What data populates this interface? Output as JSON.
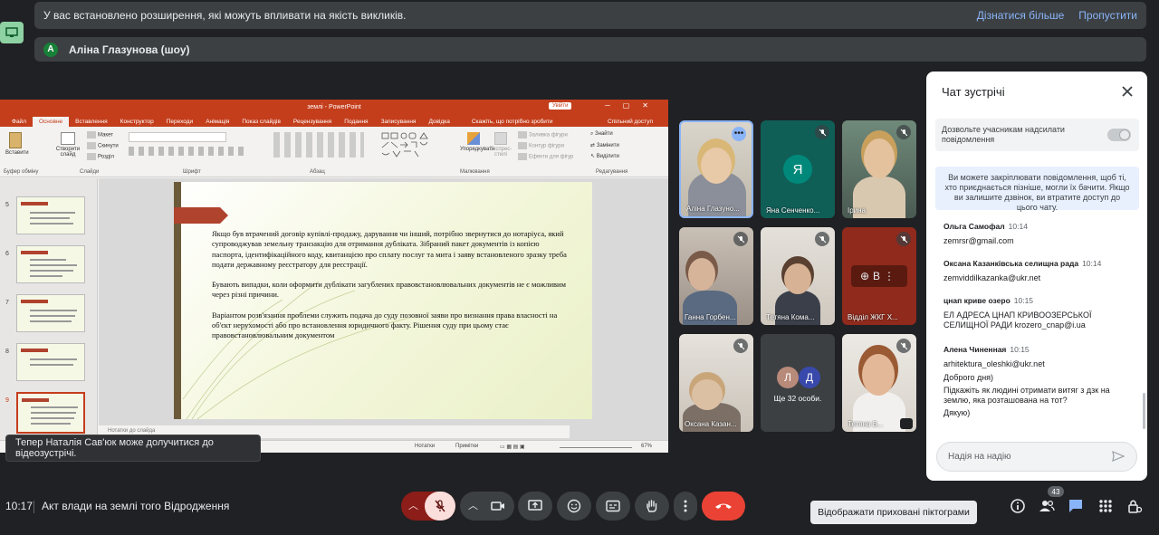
{
  "banners": {
    "extensions_text": "У вас встановлено розширення, які можуть впливати на якість викликів.",
    "learn_more": "Дізнатися більше",
    "skip": "Пропустити",
    "presenter_initial": "A",
    "presenter": "Аліна Глазунова (шоу)"
  },
  "ppt": {
    "title": "землі - PowerPoint",
    "signin": "Увійти",
    "tabs": [
      "Файл",
      "Основне",
      "Вставлення",
      "Конструктор",
      "Переходи",
      "Анімація",
      "Показ слайдів",
      "Рецензування",
      "Подання",
      "Записування",
      "Довідка"
    ],
    "hint": "Скажіть, що потрібно зробити",
    "share": "Спільний доступ",
    "ribbon": {
      "paste": "Вставити",
      "new_slide": "Створити слайд",
      "layout": "Макет",
      "reset": "Скинути",
      "section": "Розділ",
      "arrange": "Упорядкувати",
      "quick_styles": "Експрес-стилі",
      "shape_fill": "Заливка фігури",
      "shape_outline": "Контур фігури",
      "shape_effects": "Ефекти для фігур",
      "find": "Знайти",
      "replace": "Замінити",
      "select": "Виділити",
      "groups": [
        "Буфер обміну",
        "Слайди",
        "Шрифт",
        "Абзац",
        "Малювання",
        "Редагування"
      ]
    },
    "thumb_numbers": [
      "5",
      "6",
      "7",
      "8",
      "9"
    ],
    "slide_paragraphs": [
      "Якщо був втрачений договір купівлі-продажу, дарування чи інший, потрібно звернутися до нотаріуса, який супроводжував земельну транзакцію для отримання дубліката. Зібраний пакет документів із копією паспорта, ідентифікаційного коду, квитанцією про сплату послуг та мита і заяву встановленого зразку треба подати державному реєстратору для реєстрації.",
      "Бувають випадки, коли оформити дублікати загублених правовстановлювальних документів не є можливим через різні причини.",
      "Варіантом розв'язання проблеми служить подача до суду позовної заяви про визнання права власності на об'єкт нерухомості або про встановлення юридичного факту. Рішення суду при цьому стає правовстановлювальним документом"
    ],
    "notes_placeholder": "Нотатки до слайда",
    "status_notes": "Нотатки",
    "status_comments": "Примітки",
    "zoom": "67%"
  },
  "toast": "Тепер Наталія Сав'юк може долучитися до відеозустрічі.",
  "participants": [
    {
      "name": "Аліна Глазуно..."
    },
    {
      "name": "Яна Сенченко...",
      "initial": "Я"
    },
    {
      "name": "Ірина"
    },
    {
      "name": "Ганна Горбен..."
    },
    {
      "name": "Тетяна Кома..."
    },
    {
      "name": "Відділ ЖКГ Х..."
    },
    {
      "name": "Оксана Казан..."
    },
    {
      "name": "Ще 32 особи.",
      "initials": [
        "Л",
        "Д"
      ]
    },
    {
      "name": "Тетяна Б..."
    }
  ],
  "colors": {
    "ppt_accent": "#c43e1c",
    "avatar_green": "#188038",
    "avatar_teal": "#00897b",
    "end_call": "#ea4335",
    "link": "#8ab4f8"
  },
  "chat": {
    "title": "Чат зустрічі",
    "allow_messages": "Дозвольте учасникам надсилати повідомлення",
    "info": "Ви можете закріплювати повідомлення, щоб ті, хто приєднається пізніше, могли їх бачити. Якщо ви залишите дзвінок, ви втратите доступ до цього чату.",
    "messages": [
      {
        "sender": "Ольга Самофал",
        "time": "10:14",
        "lines": [
          "zemrsr@gmail.com"
        ]
      },
      {
        "sender": "Оксана Казанківська селищна рада",
        "time": "10:14",
        "lines": [
          "zemviddilkazanka@ukr.net"
        ]
      },
      {
        "sender": "цнап криве озеро",
        "time": "10:15",
        "lines": [
          "ЕЛ АДРЕСА ЦНАП КРИВООЗЕРСЬКОЇ СЕЛИЩНОЇ РАДИ krozero_cnap@i.ua"
        ]
      },
      {
        "sender": "Алена Чиненная",
        "time": "10:15",
        "lines": [
          "arhitektura_oleshki@ukr.net",
          "Доброго дня)",
          "Підкажіть як людині отримати витяг з дзк на землю, яка розташована на тот?",
          "Дякую)"
        ]
      }
    ],
    "input_placeholder": "Надія на надію"
  },
  "bottom": {
    "time": "10:17",
    "meeting": "Акт влади на землі того Відродження",
    "tooltip": "Відображати приховані піктограми",
    "people_count": "43"
  }
}
